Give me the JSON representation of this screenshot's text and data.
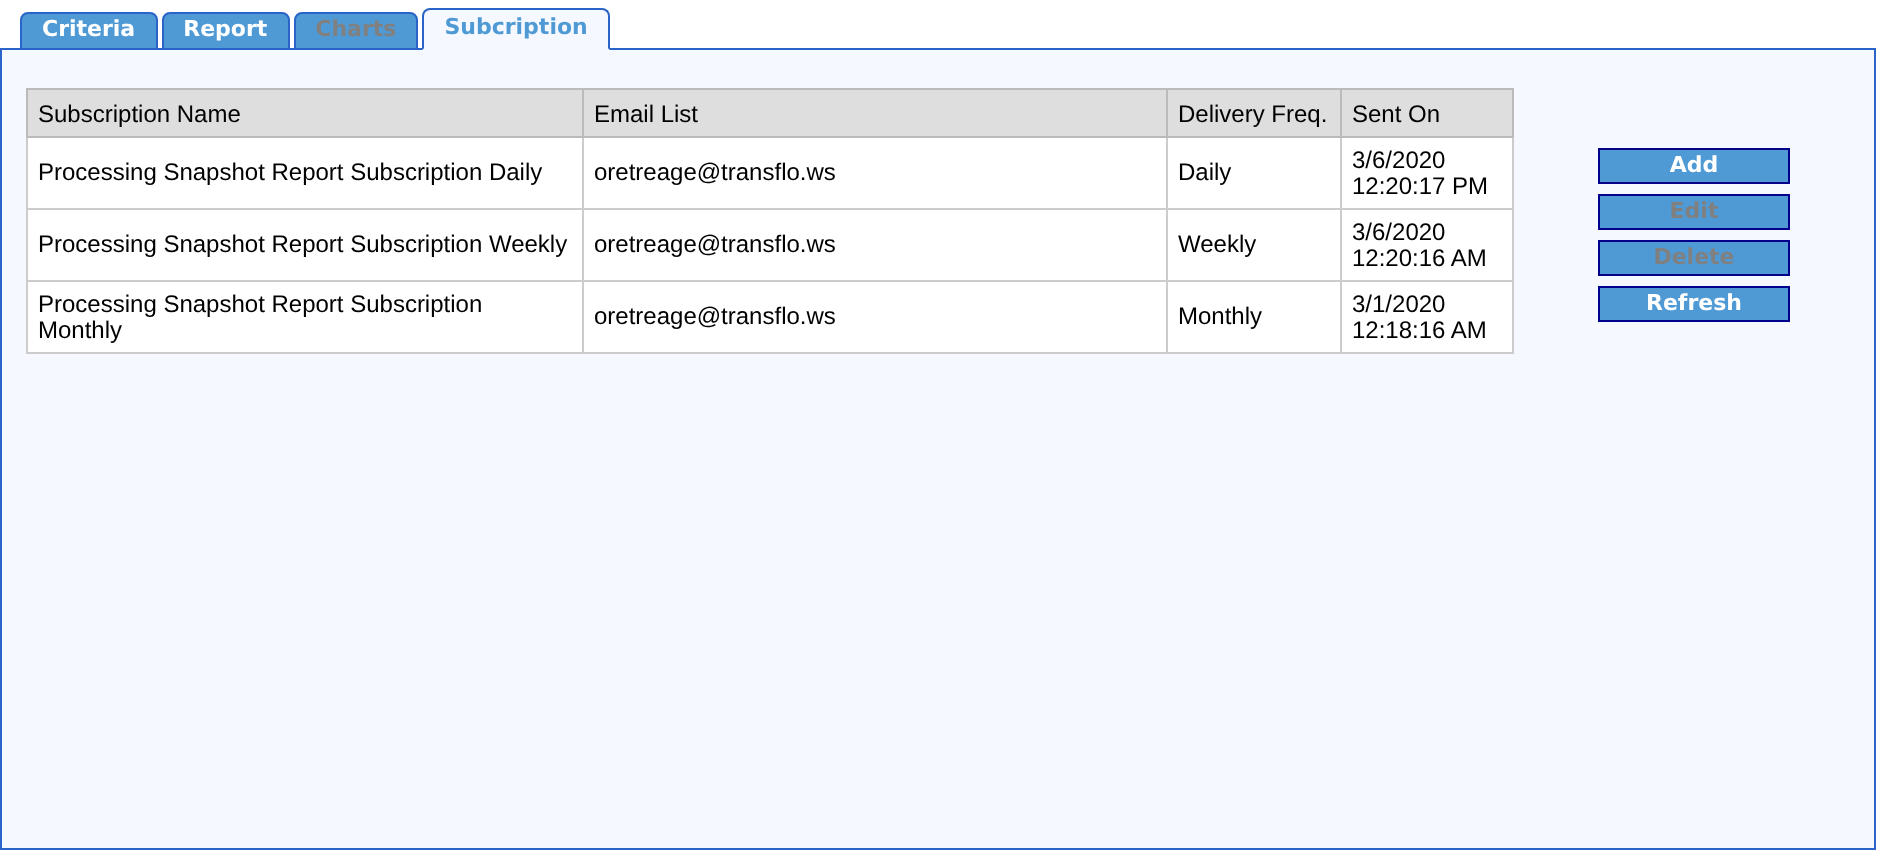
{
  "tabs": [
    {
      "label": "Criteria",
      "selected": false,
      "disabled": false
    },
    {
      "label": "Report",
      "selected": false,
      "disabled": false
    },
    {
      "label": "Charts",
      "selected": false,
      "disabled": true
    },
    {
      "label": "Subcription",
      "selected": true,
      "disabled": false
    }
  ],
  "table": {
    "columns": [
      "Subscription Name",
      "Email List",
      "Delivery Freq.",
      "Sent On"
    ],
    "rows": [
      [
        "Processing Snapshot Report Subscription Daily",
        "oretreage@transflo.ws",
        "Daily",
        "3/6/2020 12:20:17 PM"
      ],
      [
        "Processing Snapshot Report Subscription Weekly",
        "oretreage@transflo.ws",
        "Weekly",
        "3/6/2020 12:20:16 AM"
      ],
      [
        "Processing Snapshot Report Subscription Monthly",
        "oretreage@transflo.ws",
        "Monthly",
        "3/1/2020 12:18:16 AM"
      ]
    ]
  },
  "buttons": [
    {
      "label": "Add",
      "disabled": false
    },
    {
      "label": "Edit",
      "disabled": true
    },
    {
      "label": "Delete",
      "disabled": true
    },
    {
      "label": "Refresh",
      "disabled": false
    }
  ]
}
